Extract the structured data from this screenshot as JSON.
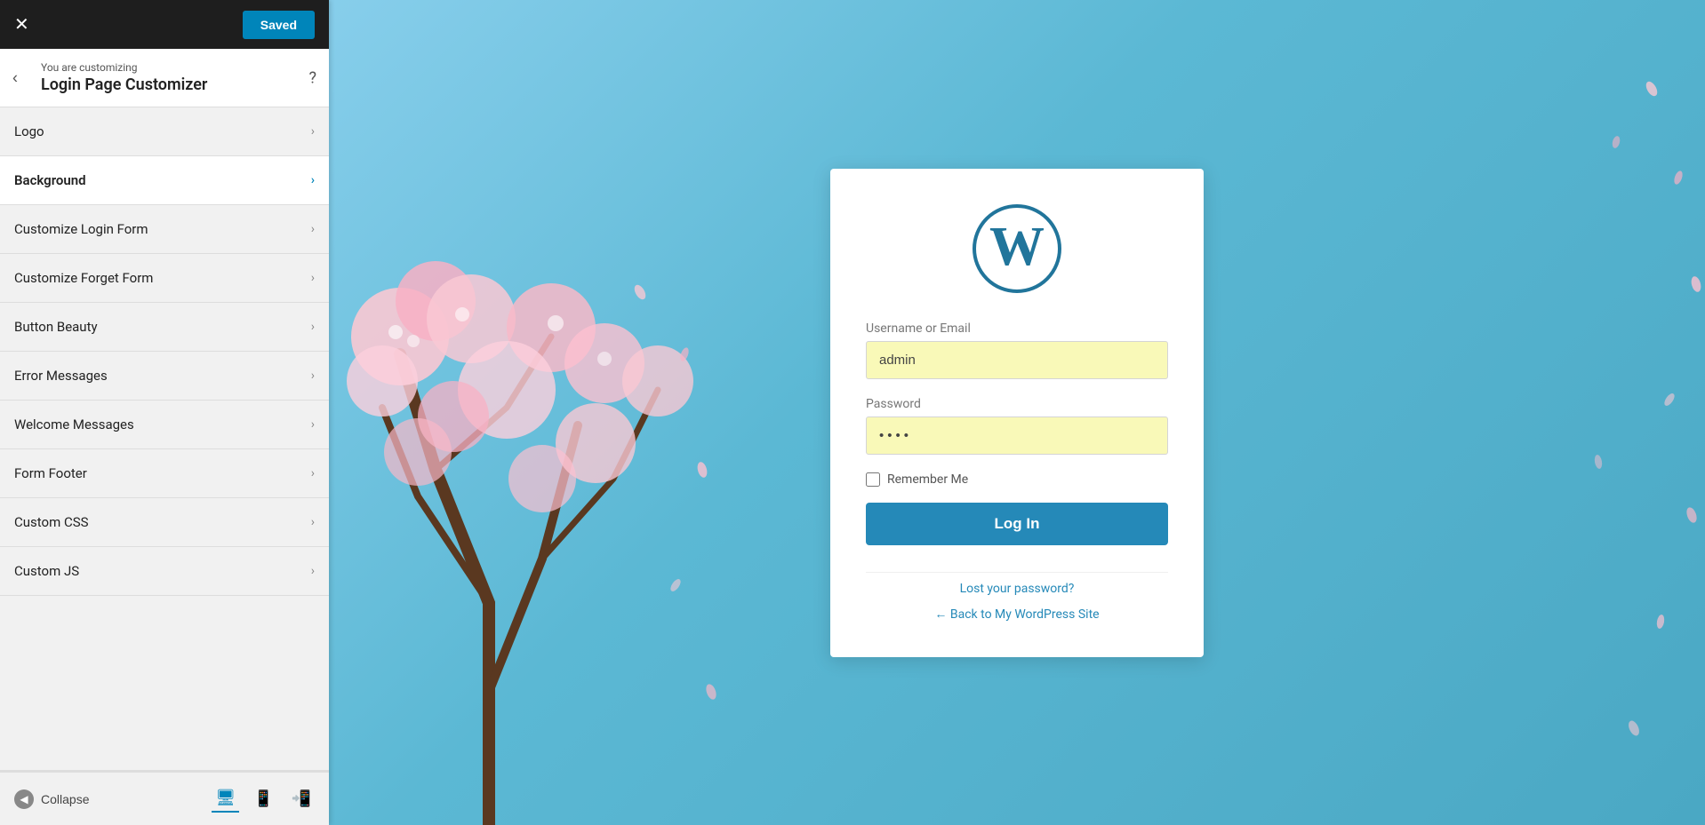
{
  "topbar": {
    "close_label": "✕",
    "saved_label": "Saved"
  },
  "header": {
    "customizing_sub": "You are customizing",
    "customizing_title": "Login Page Customizer",
    "back_label": "‹",
    "help_label": "?"
  },
  "nav": {
    "items": [
      {
        "id": "logo",
        "label": "Logo",
        "active": false
      },
      {
        "id": "background",
        "label": "Background",
        "active": true
      },
      {
        "id": "customize-login-form",
        "label": "Customize Login Form",
        "active": false
      },
      {
        "id": "customize-forget-form",
        "label": "Customize Forget Form",
        "active": false
      },
      {
        "id": "button-beauty",
        "label": "Button Beauty",
        "active": false
      },
      {
        "id": "error-messages",
        "label": "Error Messages",
        "active": false
      },
      {
        "id": "welcome-messages",
        "label": "Welcome Messages",
        "active": false
      },
      {
        "id": "form-footer",
        "label": "Form Footer",
        "active": false
      },
      {
        "id": "custom-css",
        "label": "Custom CSS",
        "active": false
      },
      {
        "id": "custom-js",
        "label": "Custom JS",
        "active": false
      }
    ]
  },
  "footer": {
    "collapse_label": "Collapse"
  },
  "login_card": {
    "username_label": "Username or Email",
    "username_value": "admin",
    "password_label": "Password",
    "password_placeholder": "••••",
    "remember_label": "Remember Me",
    "login_button": "Log In",
    "lost_password_link": "Lost your password?",
    "back_link": "← Back to My WordPress Site"
  }
}
